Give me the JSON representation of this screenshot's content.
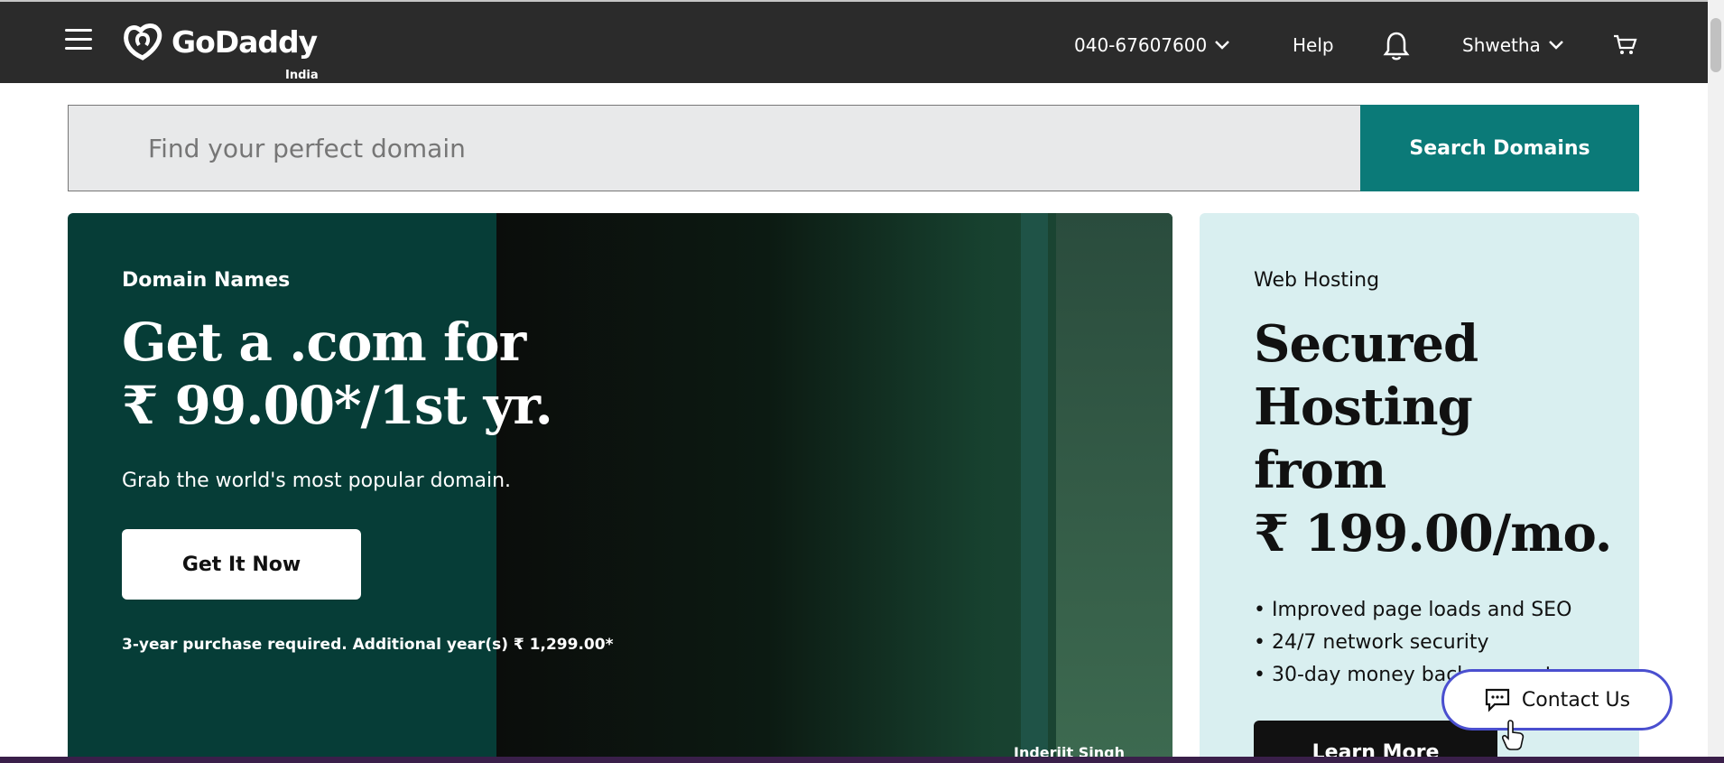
{
  "header": {
    "logo_text": "GoDaddy",
    "logo_country": "India",
    "phone": "040-67607600",
    "help": "Help",
    "user": "Shwetha",
    "icons": [
      "menu-icon",
      "godaddy-logo-icon",
      "chevron-down-icon",
      "bell-icon",
      "cart-icon"
    ]
  },
  "search": {
    "placeholder": "Find your perfect domain",
    "button": "Search Domains"
  },
  "hero": {
    "kicker": "Domain Names",
    "title_line1": "Get a .com for",
    "title_line2": "₹ 99.00*/1st yr.",
    "subtitle": "Grab the world's most popular domain.",
    "cta": "Get It Now",
    "fine_print": "3-year purchase required. Additional year(s) ₹ 1,299.00*",
    "photo_credit": "Inderjit Singh"
  },
  "promo": {
    "kicker": "Web Hosting",
    "title_line1": "Secured",
    "title_line2": "Hosting",
    "title_line3": "from",
    "title_line4": "₹ 199.00/mo.",
    "bullets": [
      "Improved page loads and SEO",
      "24/7 network security",
      "30-day money back guarantee"
    ],
    "cta": "Learn More"
  },
  "contact": {
    "label": "Contact Us"
  },
  "colors": {
    "topbar": "#2b2b2b",
    "accent_teal": "#0b7a78",
    "hero_green": "#063d37",
    "promo_bg": "#d9eff0",
    "contact_border": "#4a4fcf"
  }
}
